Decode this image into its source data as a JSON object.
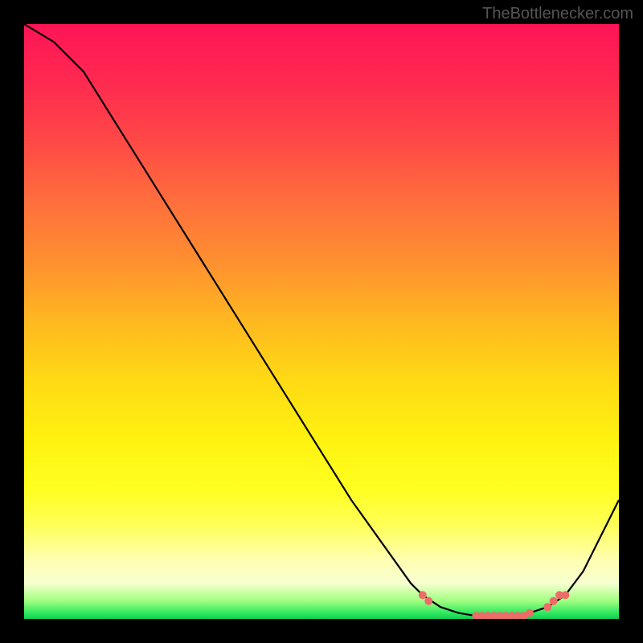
{
  "watermark": "TheBottlenecker.com",
  "chart_data": {
    "type": "line",
    "title": "",
    "xlabel": "",
    "ylabel": "",
    "xlim": [
      0,
      100
    ],
    "ylim": [
      0,
      100
    ],
    "series": [
      {
        "name": "curve",
        "x": [
          0,
          5,
          10,
          15,
          20,
          25,
          30,
          35,
          40,
          45,
          50,
          55,
          60,
          65,
          67,
          70,
          73,
          76,
          79,
          82,
          85,
          88,
          91,
          94,
          97,
          100
        ],
        "y": [
          100,
          97,
          92,
          84,
          76,
          68,
          60,
          52,
          44,
          36,
          28,
          20,
          13,
          6,
          4,
          2,
          1,
          0.5,
          0.5,
          0.5,
          1,
          2,
          4,
          8,
          14,
          20
        ]
      },
      {
        "name": "markers",
        "x": [
          67,
          68,
          76,
          77,
          78,
          79,
          80,
          81,
          82,
          83,
          84,
          85,
          88,
          89,
          90,
          91
        ],
        "y": [
          4,
          3,
          0.5,
          0.5,
          0.5,
          0.5,
          0.5,
          0.5,
          0.5,
          0.5,
          0.5,
          1,
          2,
          3,
          4,
          4
        ]
      }
    ],
    "gradient_stops": [
      {
        "pos": 0,
        "color": "#ff1456"
      },
      {
        "pos": 10,
        "color": "#ff2a50"
      },
      {
        "pos": 20,
        "color": "#ff4a46"
      },
      {
        "pos": 30,
        "color": "#ff6f3c"
      },
      {
        "pos": 40,
        "color": "#ff9030"
      },
      {
        "pos": 50,
        "color": "#ffb820"
      },
      {
        "pos": 60,
        "color": "#ffda15"
      },
      {
        "pos": 70,
        "color": "#fff210"
      },
      {
        "pos": 78,
        "color": "#ffff20"
      },
      {
        "pos": 84,
        "color": "#ffff55"
      },
      {
        "pos": 90,
        "color": "#ffffb0"
      },
      {
        "pos": 94,
        "color": "#f8ffd0"
      },
      {
        "pos": 97,
        "color": "#a0ff80"
      },
      {
        "pos": 99,
        "color": "#30e860"
      },
      {
        "pos": 100,
        "color": "#10d050"
      }
    ],
    "marker_color": "#ee6c68",
    "line_color": "#000000"
  }
}
